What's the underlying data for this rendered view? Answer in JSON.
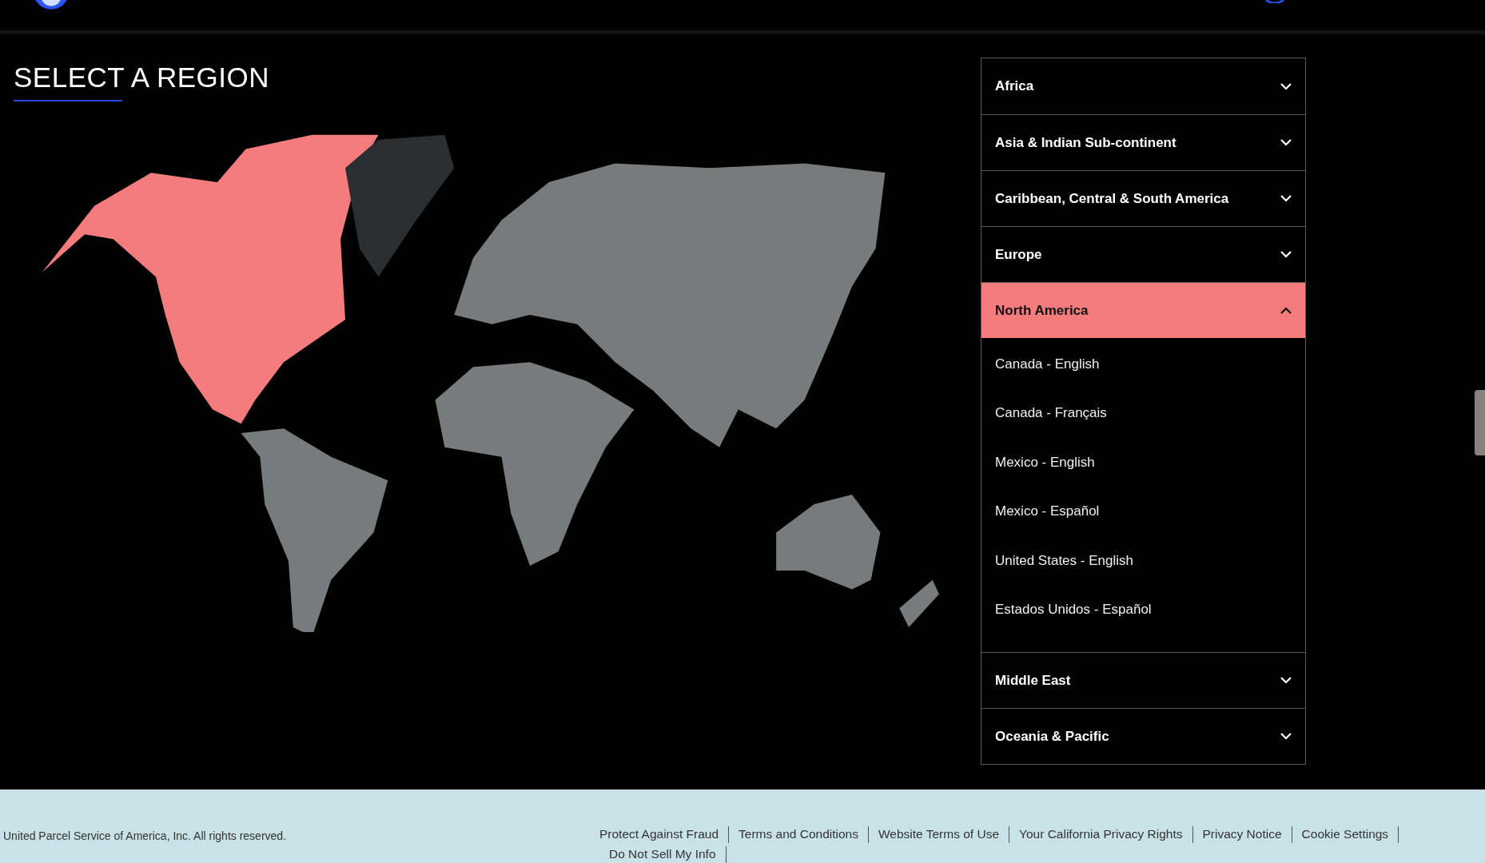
{
  "title": "SELECT A REGION",
  "regions": [
    {
      "name": "Africa",
      "expanded": false
    },
    {
      "name": "Asia & Indian Sub-continent",
      "expanded": false
    },
    {
      "name": "Caribbean, Central & South America",
      "expanded": false
    },
    {
      "name": "Europe",
      "expanded": false
    },
    {
      "name": "North America",
      "expanded": true,
      "countries": [
        "Canada - English",
        "Canada - Français",
        "Mexico - English",
        "Mexico - Español",
        "United States - English",
        "Estados Unidos - Español"
      ]
    },
    {
      "name": "Middle East",
      "expanded": false
    },
    {
      "name": "Oceania & Pacific",
      "expanded": false
    }
  ],
  "footer": {
    "copyright": "United Parcel Service of America, Inc. All rights reserved.",
    "links": [
      "Protect Against Fraud",
      "Terms and Conditions",
      "Website Terms of Use",
      "Your California Privacy Rights",
      "Privacy Notice",
      "Cookie Settings",
      "Do Not Sell My Info"
    ]
  }
}
